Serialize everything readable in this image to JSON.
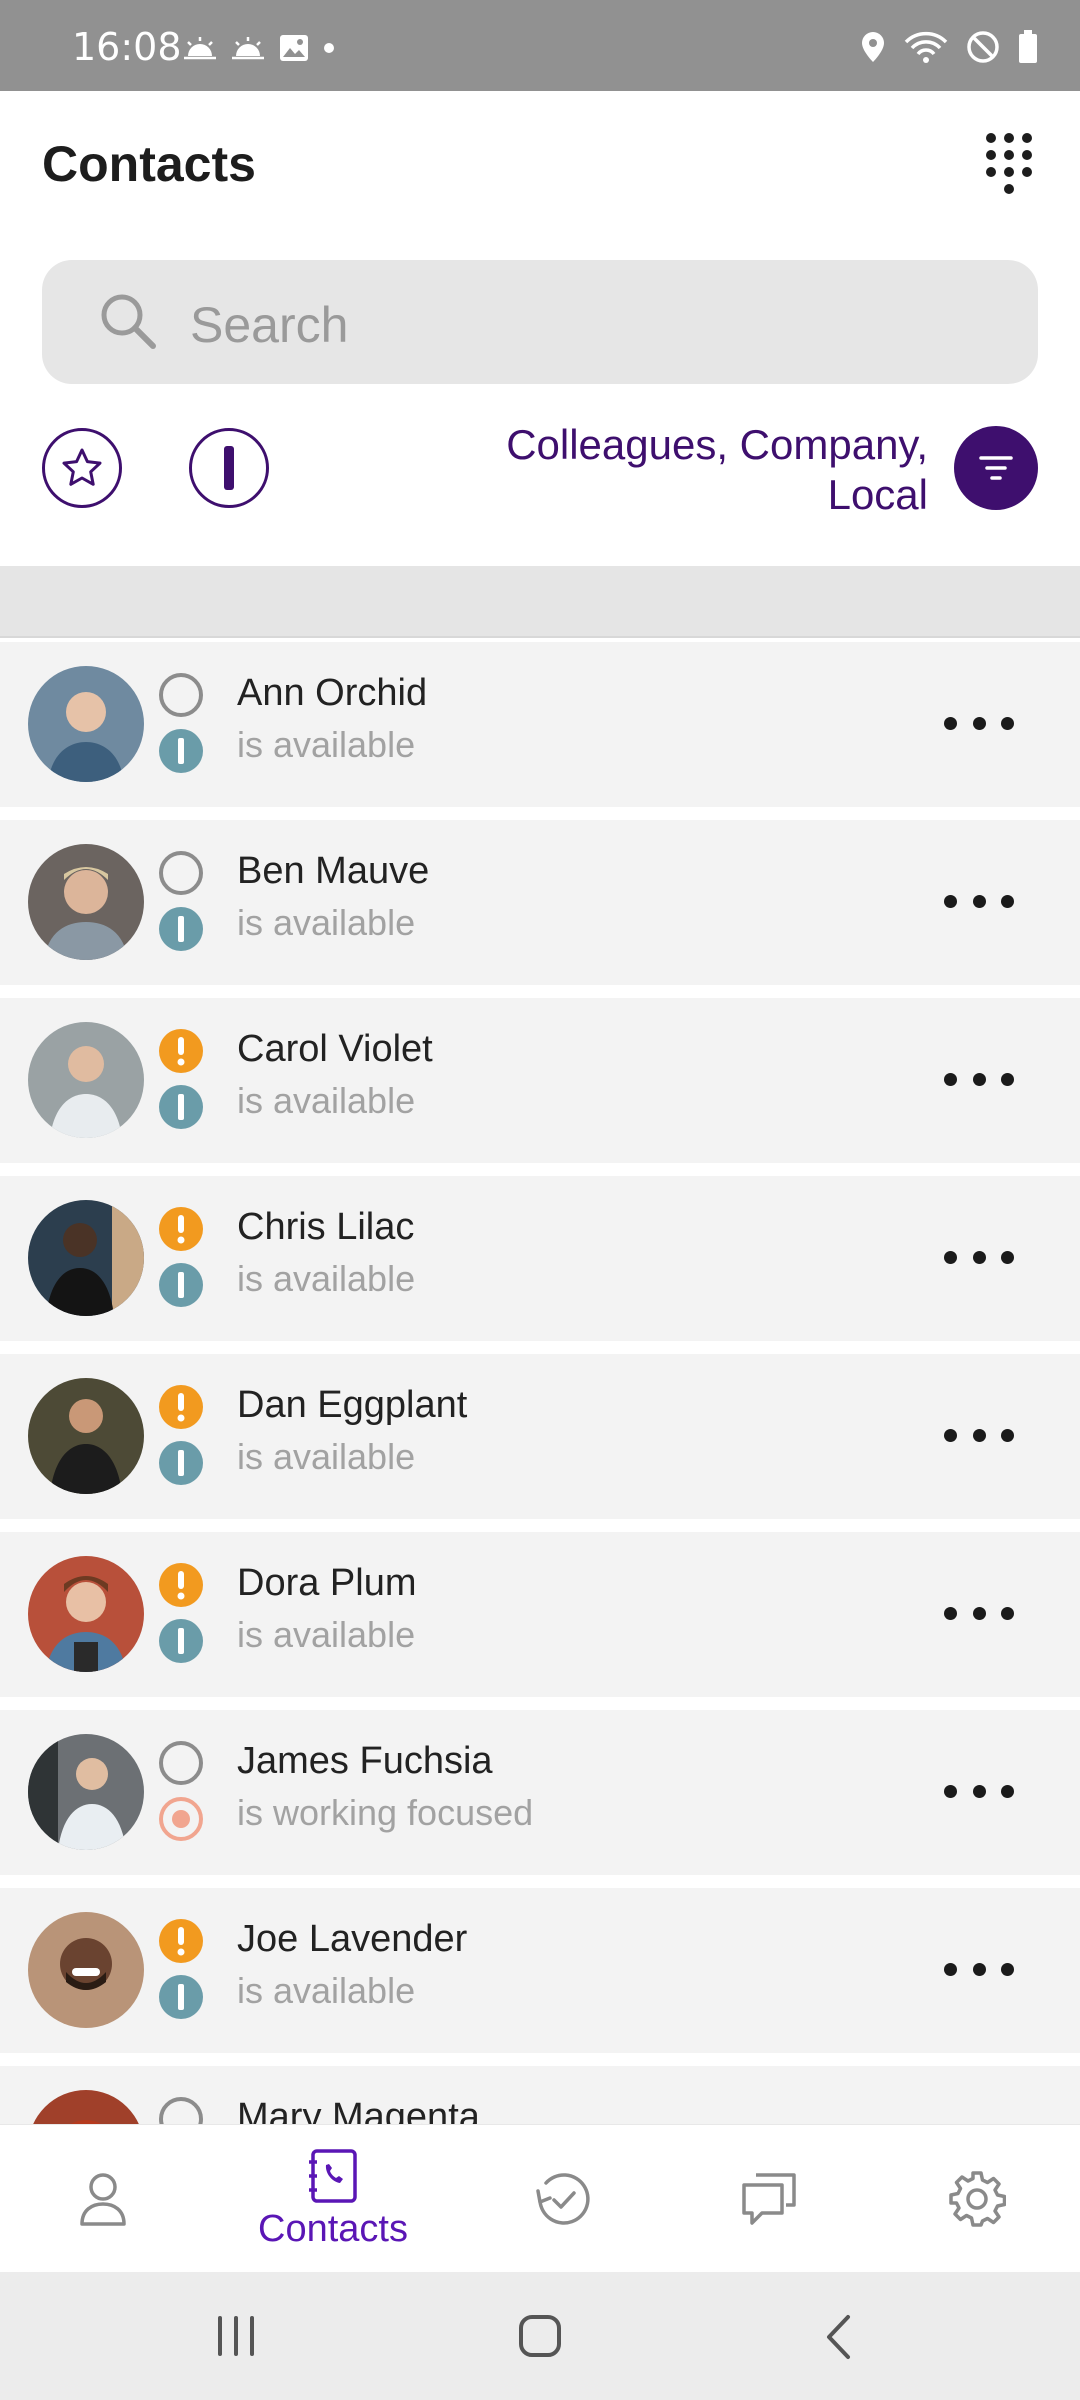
{
  "status_bar": {
    "time": "16:08",
    "left_icons": [
      "weather-icon",
      "weather-icon",
      "image-icon",
      "dot-icon"
    ],
    "right_icons": [
      "location-icon",
      "wifi-icon",
      "do-not-disturb-icon",
      "battery-icon"
    ]
  },
  "header": {
    "title": "Contacts",
    "dialpad_icon": "dialpad-icon"
  },
  "search": {
    "placeholder": "Search"
  },
  "filters": {
    "favorites_icon": "star-icon",
    "status_icon": "presence-filter-icon",
    "active_filter_line1": "Colleagues, Company,",
    "active_filter_line2": "Local",
    "filter_icon": "filter-icon"
  },
  "contacts": [
    {
      "name": "Ann Orchid",
      "status": "is available",
      "presence": "offline",
      "state": "available",
      "avatar_color": "#6f8aa0"
    },
    {
      "name": "Ben Mauve",
      "status": "is available",
      "presence": "offline",
      "state": "available",
      "avatar_color": "#6b6460"
    },
    {
      "name": "Carol Violet",
      "status": "is available",
      "presence": "alert",
      "state": "available",
      "avatar_color": "#9aa2a4"
    },
    {
      "name": "Chris Lilac",
      "status": "is available",
      "presence": "alert",
      "state": "available",
      "avatar_color": "#2c3e4e"
    },
    {
      "name": "Dan Eggplant",
      "status": "is available",
      "presence": "alert",
      "state": "available",
      "avatar_color": "#4d4a36"
    },
    {
      "name": "Dora Plum",
      "status": "is available",
      "presence": "alert",
      "state": "available",
      "avatar_color": "#b8503a"
    },
    {
      "name": "James Fuchsia",
      "status": "is working focused",
      "presence": "offline",
      "state": "focused",
      "avatar_color": "#6c7074"
    },
    {
      "name": "Joe Lavender",
      "status": "is available",
      "presence": "alert",
      "state": "available",
      "avatar_color": "#b99478"
    },
    {
      "name": "Mary Magenta",
      "status": "",
      "presence": "offline",
      "state": "available",
      "avatar_color": "#a0402a"
    }
  ],
  "colors": {
    "brand": "#3e0f6e",
    "accent_nav": "#5a16b5",
    "alert": "#f29a1f",
    "available": "#6a9ca9",
    "focused": "#f1a58f"
  },
  "bottom_nav": {
    "items": [
      {
        "id": "profile",
        "icon": "person-icon",
        "label": ""
      },
      {
        "id": "contacts",
        "icon": "contacts-book-icon",
        "label": "Contacts",
        "active": true
      },
      {
        "id": "history",
        "icon": "history-icon",
        "label": ""
      },
      {
        "id": "chat",
        "icon": "chat-icon",
        "label": ""
      },
      {
        "id": "settings",
        "icon": "gear-icon",
        "label": ""
      }
    ]
  }
}
